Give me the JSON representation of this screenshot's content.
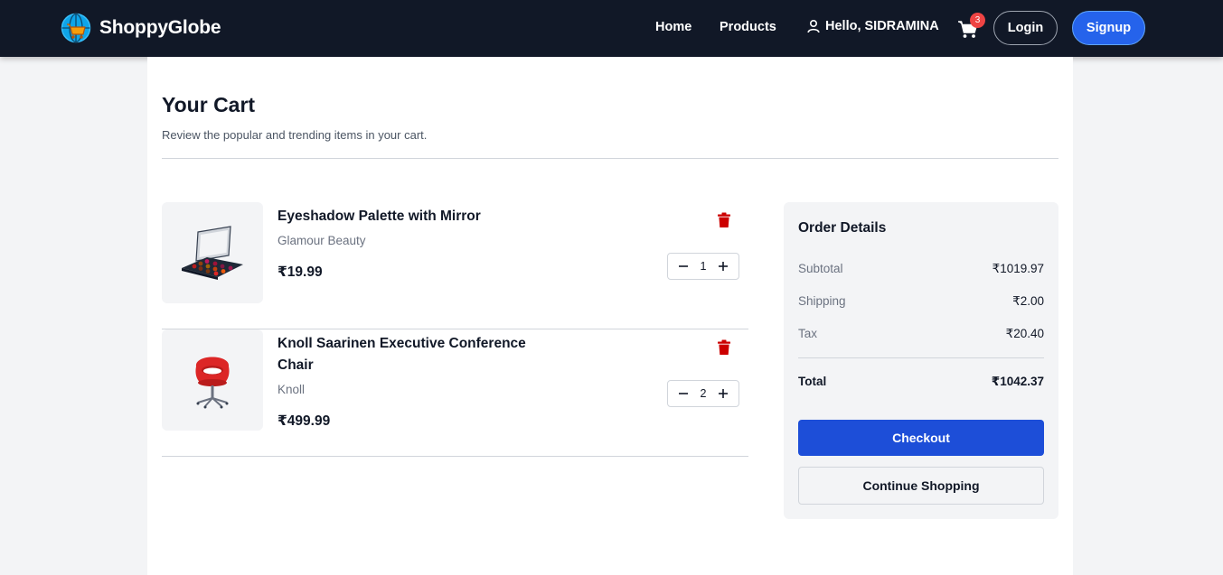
{
  "nav": {
    "brand": "ShoppyGlobe",
    "links": {
      "home": "Home",
      "products": "Products"
    },
    "greeting": "Hello, SIDRAMINA",
    "cart_count": "3",
    "login_label": "Login",
    "signup_label": "Signup"
  },
  "cart": {
    "title": "Your Cart",
    "subtitle": "Review the popular and trending items in your cart.",
    "items": [
      {
        "name": "Eyeshadow Palette with Mirror",
        "brand": "Glamour Beauty",
        "price": "₹19.99",
        "qty": "1"
      },
      {
        "name": "Knoll Saarinen Executive Conference Chair",
        "brand": "Knoll",
        "price": "₹499.99",
        "qty": "2"
      }
    ]
  },
  "order": {
    "title": "Order Details",
    "subtotal_label": "Subtotal",
    "subtotal": "₹1019.97",
    "shipping_label": "Shipping",
    "shipping": "₹2.00",
    "tax_label": "Tax",
    "tax": "₹20.40",
    "total_label": "Total",
    "total": "₹1042.37",
    "checkout_label": "Checkout",
    "continue_label": "Continue Shopping"
  },
  "colors": {
    "navbar_bg": "#111827",
    "primary": "#1d4ed8",
    "badge": "#ef4444",
    "trash": "#dc2626"
  }
}
